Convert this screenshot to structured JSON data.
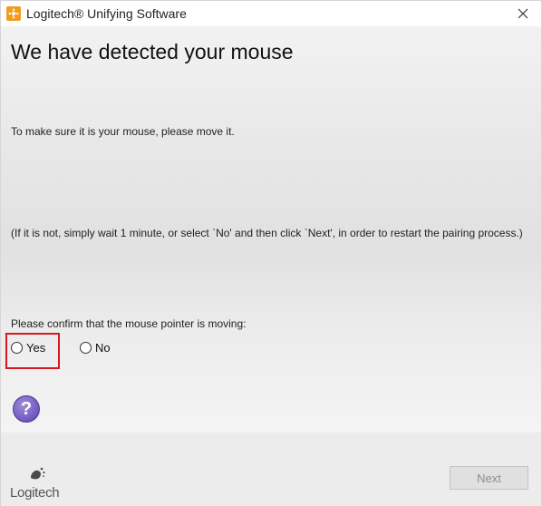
{
  "window": {
    "title": "Logitech® Unifying Software",
    "icon": "logitech-unifying-icon",
    "close_icon": "close-icon"
  },
  "main": {
    "heading": "We have detected your mouse",
    "instruction": "To make sure it is your mouse, please move it.",
    "note": "(If it is not, simply wait 1 minute, or select `No' and then click `Next', in order to restart the pairing process.)",
    "confirm_prompt": "Please confirm that the mouse pointer is moving:",
    "options": [
      {
        "label": "Yes",
        "selected": false,
        "highlighted": true
      },
      {
        "label": "No",
        "selected": false,
        "highlighted": false
      }
    ],
    "help_label": "?"
  },
  "footer": {
    "logo_text": "Logitech",
    "next_label": "Next",
    "next_enabled": false
  },
  "colors": {
    "highlight_border": "#d71920",
    "help_button": "#7b62c6",
    "app_icon": "#f29b21"
  }
}
